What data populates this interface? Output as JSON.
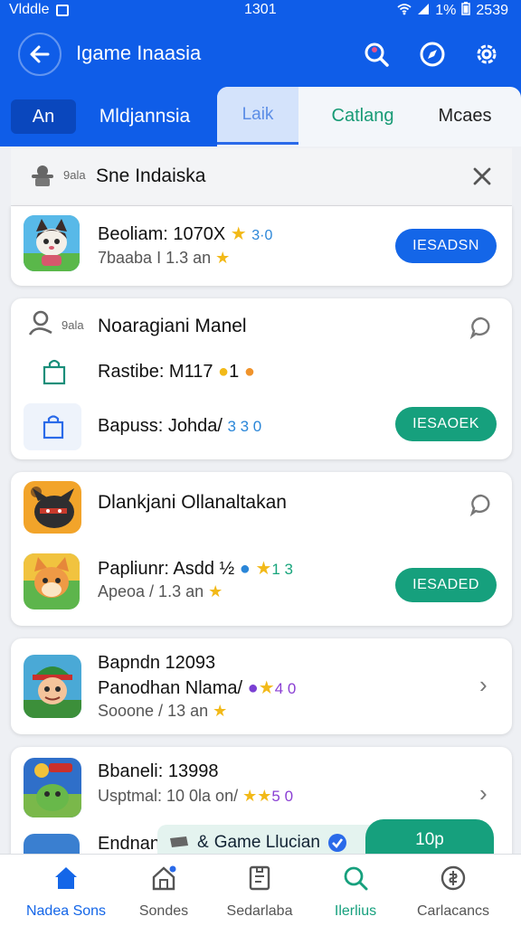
{
  "status_bar": {
    "left_text": "Vlddle",
    "time": "1301",
    "battery": "1%",
    "right_time": "2539"
  },
  "app_bar": {
    "title": "Igame Inaasia"
  },
  "tabs": {
    "app": "An",
    "mid": "Mldjannsia",
    "laik": "Laik",
    "catalog": "Catlang",
    "more": "Mcaes"
  },
  "section_header": {
    "prefix": "9ala",
    "title": "Sne Indaiska"
  },
  "cards": [
    {
      "rows": [
        {
          "title": "Beoliam: 1070X",
          "rating": "3·0",
          "sub": "7baaba I 1.3 an",
          "button": "IESADSN"
        }
      ]
    },
    {
      "header": {
        "prefix": "9ala",
        "title": "Noaragiani Manel"
      },
      "rows": [
        {
          "title": "Rastibe: M117",
          "extra": "1"
        },
        {
          "title": "Bapuss: Johda/",
          "rating": "3 3 0",
          "button": "IESAOEK"
        }
      ]
    },
    {
      "header": {
        "title": "Dlankjani Ollanaltakan"
      },
      "rows": [
        {
          "title": "Papliunr: Asdd  ½",
          "rating": "1 3",
          "sub": "Apeoa / 1.3 an",
          "button": "IESADED"
        }
      ]
    },
    {
      "rows": [
        {
          "title": "Bapndn 12093",
          "title2": "Panodhan Nlama/",
          "rating": "4 0",
          "sub": "Sooone / 13 an"
        }
      ]
    },
    {
      "rows": [
        {
          "title": "Bbaneli: 13998",
          "sub": "Usptmal: 10 0la on/",
          "rating": "5 0"
        },
        {
          "title": "Endnand"
        }
      ]
    }
  ],
  "floating_bar": {
    "left_text": "Game Llucian",
    "right_text": "10p"
  },
  "bottom_nav": [
    {
      "label": "Nadea Sons",
      "active": true
    },
    {
      "label": "Sondes"
    },
    {
      "label": "Sedarlaba"
    },
    {
      "label": "Ilerlius"
    },
    {
      "label": "Carlacancs"
    }
  ],
  "colors": {
    "primary": "#0f5de8",
    "green": "#16a07d",
    "star": "#f2b918"
  }
}
